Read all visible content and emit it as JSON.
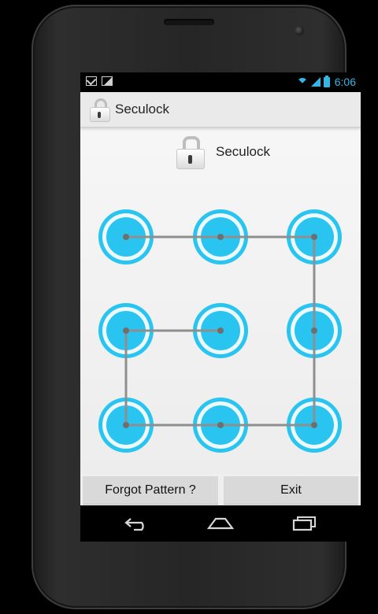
{
  "status_bar": {
    "left_icons": [
      "gmail-icon",
      "image-icon"
    ],
    "right_icons": [
      "wifi-icon",
      "signal-icon",
      "battery-icon"
    ],
    "time": "6:06",
    "accent_color": "#33b5e5"
  },
  "action_bar": {
    "icon": "lock-icon",
    "title": "Seculock"
  },
  "header": {
    "icon": "lock-icon",
    "title": "Seculock"
  },
  "pattern": {
    "dot_color": "#29c4f0",
    "line_color": "#8f8f8f",
    "dots": [
      1,
      2,
      3,
      4,
      5,
      6,
      7,
      8,
      9
    ],
    "path": [
      1,
      2,
      3,
      6,
      9,
      8,
      7,
      4,
      5
    ]
  },
  "buttons": {
    "forgot_label": "Forgot Pattern ?",
    "exit_label": "Exit"
  },
  "nav_bar": {
    "icons": [
      "back-icon",
      "home-icon",
      "recent-apps-icon"
    ]
  }
}
